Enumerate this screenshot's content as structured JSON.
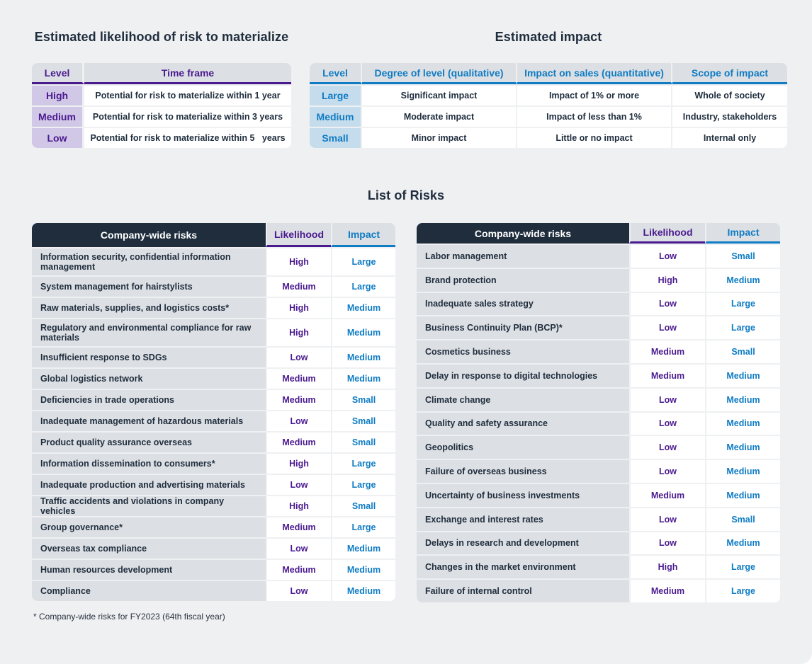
{
  "likelihood_section": {
    "title": "Estimated likelihood of risk to materialize",
    "headers": {
      "level": "Level",
      "time_frame": "Time frame"
    },
    "rows": [
      {
        "level": "High",
        "time_frame": "Potential for risk to materialize within 1 year"
      },
      {
        "level": "Medium",
        "time_frame": "Potential for risk to materialize within 3 years"
      },
      {
        "level": "Low",
        "time_frame": "Potential for risk to materialize within 5   years"
      }
    ]
  },
  "impact_section": {
    "title": "Estimated impact",
    "headers": {
      "level": "Level",
      "degree": "Degree of level (qualitative)",
      "sales": "Impact on sales (quantitative)",
      "scope": "Scope of impact"
    },
    "rows": [
      {
        "level": "Large",
        "degree": "Significant impact",
        "sales": "Impact of 1% or more",
        "scope": "Whole of society"
      },
      {
        "level": "Medium",
        "degree": "Moderate impact",
        "sales": "Impact of less than 1%",
        "scope": "Industry, stakeholders"
      },
      {
        "level": "Small",
        "degree": "Minor impact",
        "sales": "Little or no impact",
        "scope": "Internal only"
      }
    ]
  },
  "risk_list": {
    "title": "List of Risks",
    "headers": {
      "name": "Company-wide risks",
      "likelihood": "Likelihood",
      "impact": "Impact"
    },
    "left_rows": [
      {
        "name": "Information security, confidential information management",
        "likelihood": "High",
        "impact": "Large"
      },
      {
        "name": "System management for hairstylists",
        "likelihood": "Medium",
        "impact": "Large"
      },
      {
        "name": "Raw materials, supplies, and logistics costs*",
        "likelihood": "High",
        "impact": "Medium"
      },
      {
        "name": "Regulatory and environmental compliance for raw materials",
        "likelihood": "High",
        "impact": "Medium"
      },
      {
        "name": "Insufficient response to SDGs",
        "likelihood": "Low",
        "impact": "Medium"
      },
      {
        "name": "Global logistics network",
        "likelihood": "Medium",
        "impact": "Medium"
      },
      {
        "name": "Deficiencies in trade operations",
        "likelihood": "Medium",
        "impact": "Small"
      },
      {
        "name": "Inadequate management of hazardous materials",
        "likelihood": "Low",
        "impact": "Small"
      },
      {
        "name": "Product quality assurance overseas",
        "likelihood": "Medium",
        "impact": "Small"
      },
      {
        "name": "Information dissemination to consumers*",
        "likelihood": "High",
        "impact": "Large"
      },
      {
        "name": "Inadequate production and advertising materials",
        "likelihood": "Low",
        "impact": "Large"
      },
      {
        "name": "Traffic accidents and violations in company vehicles",
        "likelihood": "High",
        "impact": "Small"
      },
      {
        "name": "Group governance*",
        "likelihood": "Medium",
        "impact": "Large"
      },
      {
        "name": "Overseas tax compliance",
        "likelihood": "Low",
        "impact": "Medium"
      },
      {
        "name": "Human resources development",
        "likelihood": "Medium",
        "impact": "Medium"
      },
      {
        "name": "Compliance",
        "likelihood": "Low",
        "impact": "Medium"
      }
    ],
    "right_rows": [
      {
        "name": "Labor management",
        "likelihood": "Low",
        "impact": "Small"
      },
      {
        "name": "Brand protection",
        "likelihood": "High",
        "impact": "Medium"
      },
      {
        "name": "Inadequate sales strategy",
        "likelihood": "Low",
        "impact": "Large"
      },
      {
        "name": "Business Continuity Plan (BCP)*",
        "likelihood": "Low",
        "impact": "Large"
      },
      {
        "name": "Cosmetics business",
        "likelihood": "Medium",
        "impact": "Small"
      },
      {
        "name": "Delay in response to digital technologies",
        "likelihood": "Medium",
        "impact": "Medium"
      },
      {
        "name": "Climate change",
        "likelihood": "Low",
        "impact": "Medium"
      },
      {
        "name": "Quality and safety assurance",
        "likelihood": "Low",
        "impact": "Medium"
      },
      {
        "name": "Geopolitics",
        "likelihood": "Low",
        "impact": "Medium"
      },
      {
        "name": "Failure of overseas business",
        "likelihood": "Low",
        "impact": "Medium"
      },
      {
        "name": "Uncertainty of business investments",
        "likelihood": "Medium",
        "impact": "Medium"
      },
      {
        "name": "Exchange and interest rates",
        "likelihood": "Low",
        "impact": "Small"
      },
      {
        "name": "Delays in research and development",
        "likelihood": "Low",
        "impact": "Medium"
      },
      {
        "name": "Changes in the market environment",
        "likelihood": "High",
        "impact": "Large"
      },
      {
        "name": "Failure of internal control",
        "likelihood": "Medium",
        "impact": "Large"
      }
    ]
  },
  "footnote": "* Company-wide risks for FY2023 (64th fiscal year)",
  "colors": {
    "likelihood_accent": "#4a1a8f",
    "impact_accent": "#0f7cc4",
    "header_dark": "#1f2d3d",
    "background": "#eff0f2"
  }
}
